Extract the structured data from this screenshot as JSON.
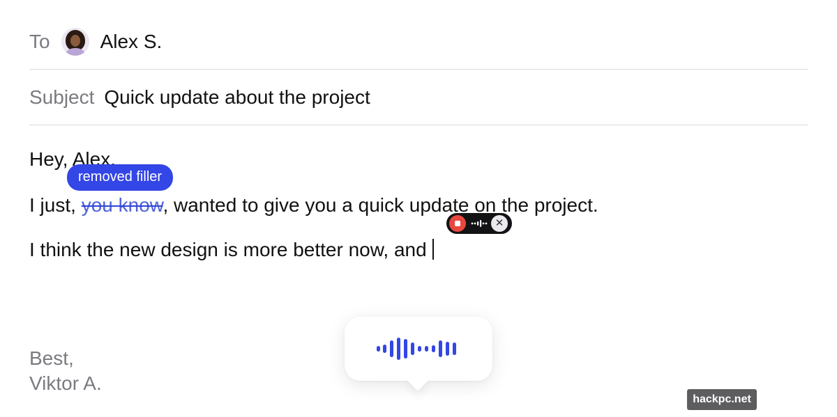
{
  "compose": {
    "to_label": "To",
    "recipient_name": "Alex S.",
    "subject_label": "Subject",
    "subject_value": "Quick update about the project"
  },
  "body": {
    "greeting": "Hey, Alex.",
    "line2_start": "I just, ",
    "line2_removed": "you know",
    "line2_end": ", wanted to give you a quick update on the project.",
    "line3": "I think the new design is more better now, and",
    "signoff_line1": "Best,",
    "signoff_line2": "Viktor A."
  },
  "annotation": {
    "removed_filler_label": "removed filler"
  },
  "recorder": {
    "close_glyph": "✕"
  },
  "icons": {
    "record_stop": "record-stop-icon",
    "mini_waveform": "waveform-icon",
    "close": "close-icon",
    "voice_waveform": "voice-waveform-icon"
  },
  "colors": {
    "accent": "#3346e6",
    "record": "#e8483f",
    "muted_text": "#7a7a80"
  },
  "watermark": {
    "text": "hackpc.net"
  }
}
